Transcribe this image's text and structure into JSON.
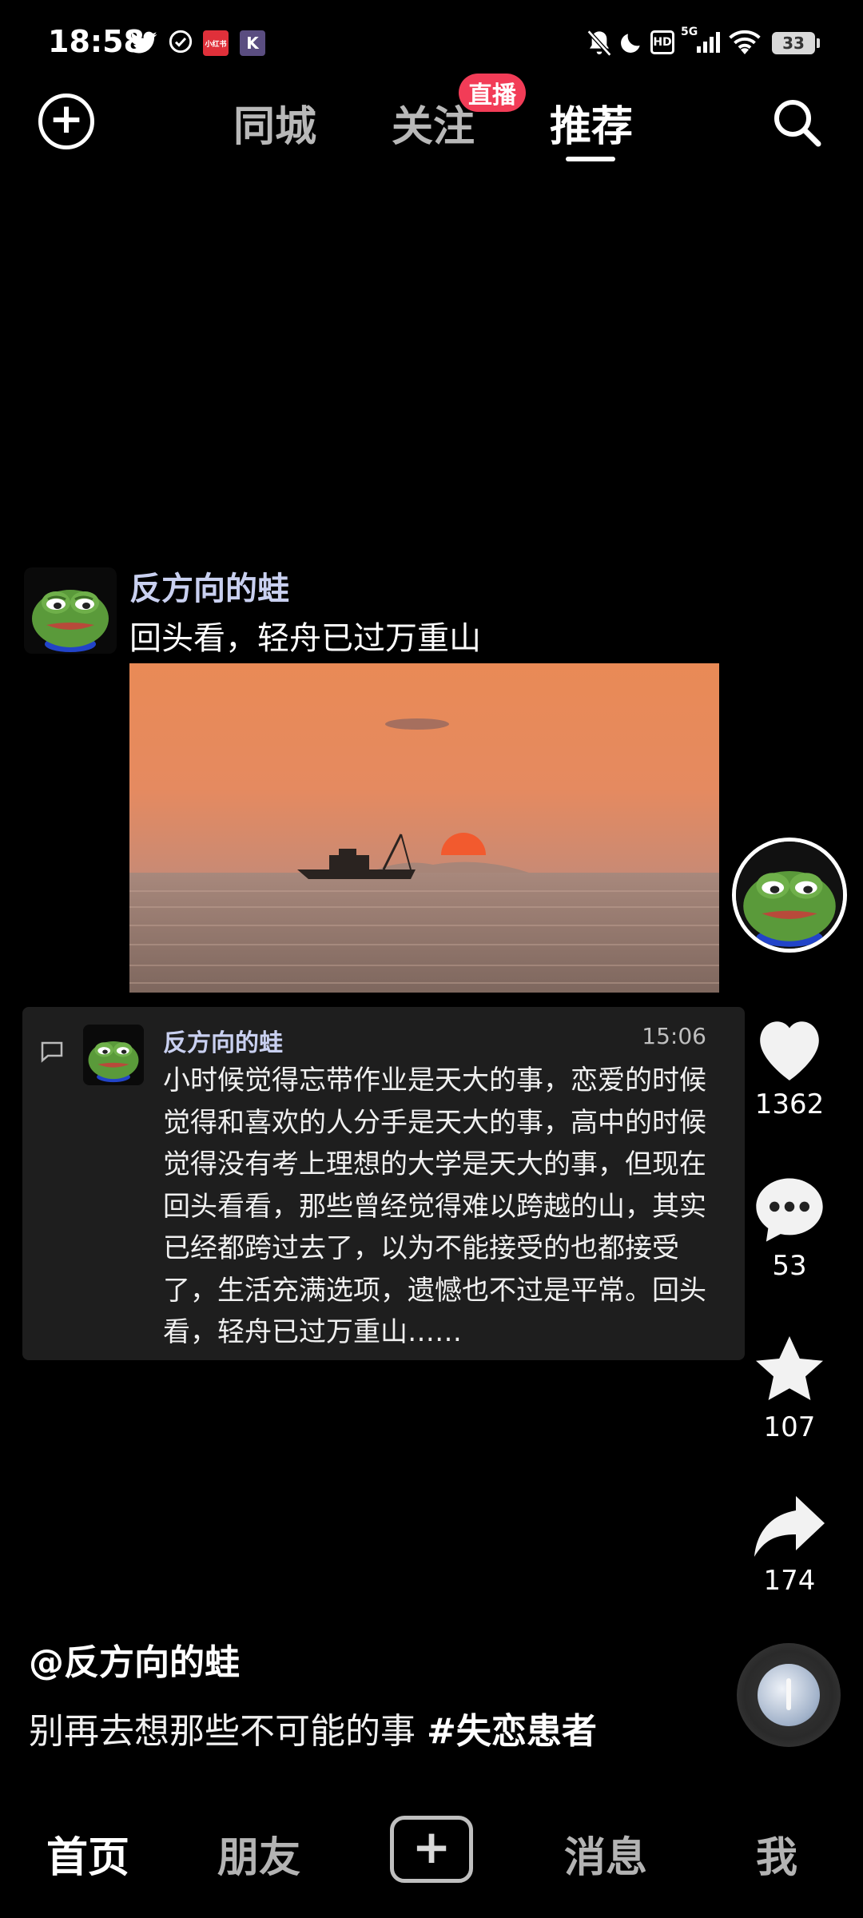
{
  "status_bar": {
    "time": "18:58",
    "app_badge_xhs": "小红书",
    "app_badge_k": "K",
    "network": "5G",
    "hd_label": "HD",
    "battery_level": "33"
  },
  "top_nav": {
    "tabs": [
      {
        "label": "同城",
        "active": false
      },
      {
        "label": "关注",
        "active": false,
        "badge": "直播"
      },
      {
        "label": "推荐",
        "active": true
      }
    ]
  },
  "post": {
    "username": "反方向的蛙",
    "caption": "回头看，轻舟已过万重山",
    "image": "sunset-boat-sea"
  },
  "comment": {
    "username": "反方向的蛙",
    "time": "15:06",
    "text": "小时候觉得忘带作业是天大的事，恋爱的时候觉得和喜欢的人分手是天大的事，高中的时候觉得没有考上理想的大学是天大的事，但现在回头看看，那些曾经觉得难以跨越的山，其实已经都跨过去了，以为不能接受的也都接受了，生活充满选项，遗憾也不过是平常。回头看，轻舟已过万重山……"
  },
  "rail": {
    "likes": "1362",
    "comments": "53",
    "favorites": "107",
    "shares": "174"
  },
  "description": {
    "author": "@反方向的蛙",
    "text": "别再去想那些不可能的事 ",
    "hashtag": "#失恋患者"
  },
  "bottom_nav": {
    "home": "首页",
    "friends": "朋友",
    "messages": "消息",
    "me": "我",
    "publish": "+"
  },
  "colors": {
    "background": "#000000",
    "live_badge": "#f23c57",
    "username": "#c9d0f0",
    "card": "#1e1e1e"
  }
}
